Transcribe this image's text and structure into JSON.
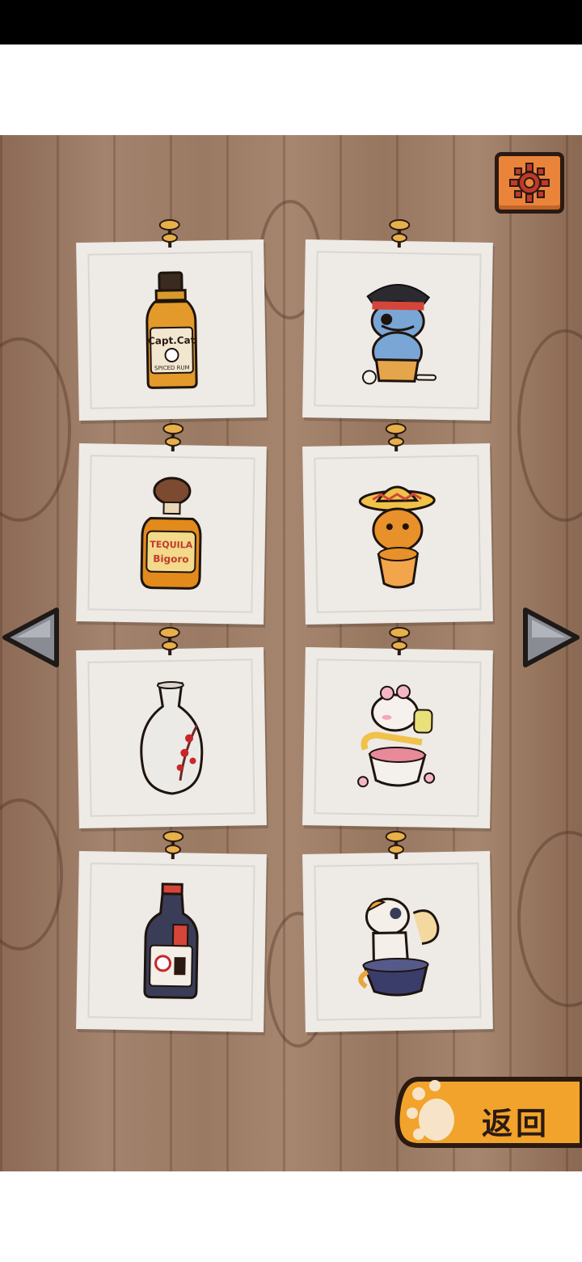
{
  "settings": {
    "icon": "gear-icon",
    "color": "#e9843a"
  },
  "navigation": {
    "prev_icon": "arrow-left-icon",
    "next_icon": "arrow-right-icon"
  },
  "cards": [
    {
      "id": "card-1",
      "label": "Capt.Cat",
      "sub": "SPICED RUM",
      "art": "rum-bottle"
    },
    {
      "id": "card-2",
      "art": "pirate-cat"
    },
    {
      "id": "card-3",
      "label": "TEQUILA",
      "sub": "Bigoro",
      "art": "tequila-bottle"
    },
    {
      "id": "card-4",
      "art": "sombrero-cat"
    },
    {
      "id": "card-5",
      "art": "sake-vase"
    },
    {
      "id": "card-6",
      "art": "blossom-cat"
    },
    {
      "id": "card-7",
      "art": "sake-bottle"
    },
    {
      "id": "card-8",
      "art": "bowl-cat"
    }
  ],
  "back_button": {
    "label": "返回",
    "icon": "paw-icon",
    "color": "#f2a32b"
  }
}
